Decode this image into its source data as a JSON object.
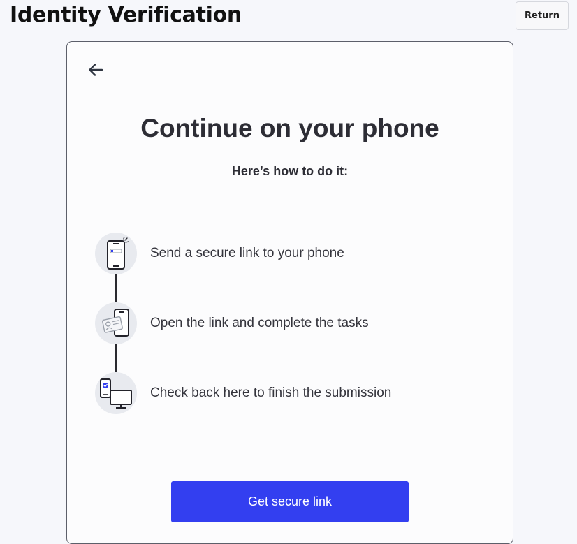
{
  "header": {
    "title": "Identity Verification",
    "return_label": "Return"
  },
  "card": {
    "back_icon": "arrow-left-icon",
    "heading": "Continue on your phone",
    "subheading": "Here’s how to do it:",
    "steps": [
      {
        "icon": "phone-link-icon",
        "text": "Send a secure link to your phone"
      },
      {
        "icon": "phone-id-card-icon",
        "text": "Open the link and complete the tasks"
      },
      {
        "icon": "phone-desktop-check-icon",
        "text": "Check back here to finish the submission"
      }
    ],
    "cta_label": "Get secure link"
  },
  "colors": {
    "accent": "#333ff0",
    "page_background": "#f6f7fb",
    "card_background": "#fcfcfd",
    "step_circle": "#e8eaef"
  }
}
